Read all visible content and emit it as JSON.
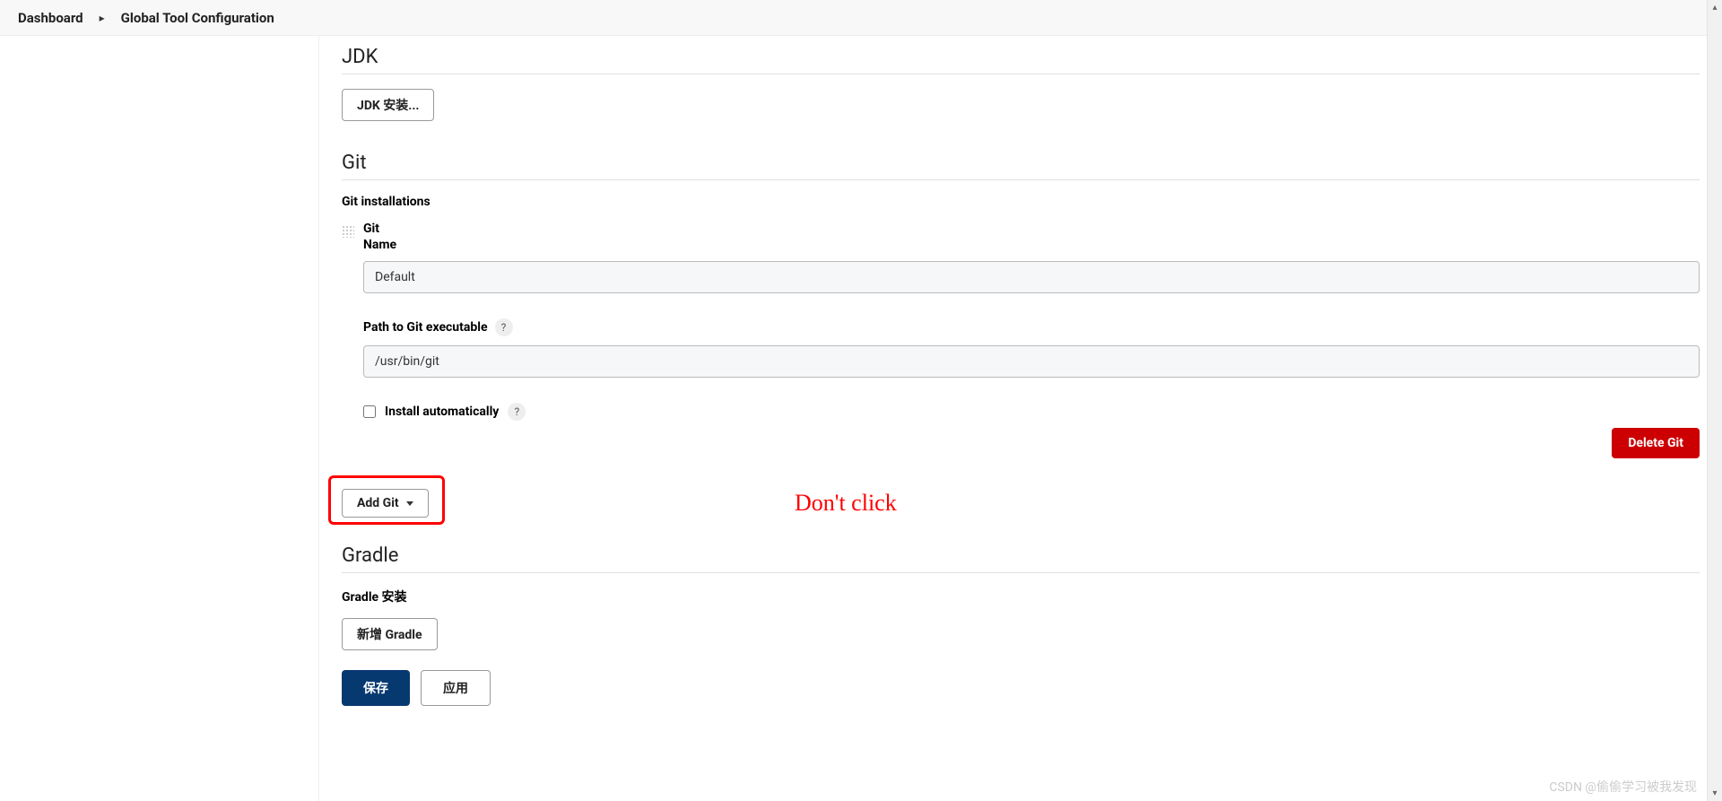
{
  "breadcrumb": {
    "dashboard": "Dashboard",
    "current": "Global Tool Configuration"
  },
  "sections": {
    "jdk": {
      "title": "JDK",
      "addButton": "JDK 安装..."
    },
    "git": {
      "title": "Git",
      "installationsLabel": "Git installations",
      "toolHeading": "Git",
      "nameLabel": "Name",
      "nameValue": "Default",
      "pathLabel": "Path to Git executable",
      "pathValue": "/usr/bin/git",
      "installAutoLabel": "Install automatically",
      "deleteButton": "Delete Git",
      "addButton": "Add Git"
    },
    "gradle": {
      "title": "Gradle",
      "installLabel": "Gradle 安装",
      "addButton": "新增 Gradle"
    }
  },
  "annotation": {
    "text": "Don't click"
  },
  "footer": {
    "save": "保存",
    "apply": "应用"
  },
  "watermark": "CSDN @偷偷学习被我发现",
  "help": "?"
}
